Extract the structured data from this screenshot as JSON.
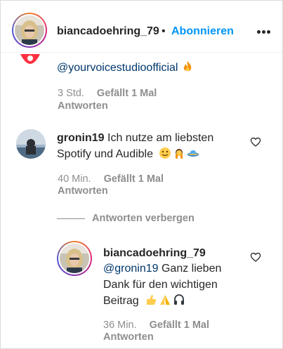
{
  "header": {
    "username": "biancadoehring_79",
    "separator": "•",
    "follow_label": "Abonnieren"
  },
  "partial_comment": {
    "mention": "@yourvoicestudioofficial",
    "time": "3 Std.",
    "likes": "Gefällt 1 Mal",
    "reply_label": "Antworten"
  },
  "comment_gronin": {
    "username": "gronin19",
    "text_line1": "Ich nutze am liebsten",
    "text_line2": "Spotify und Audible",
    "time": "40 Min.",
    "likes": "Gefällt 1 Mal",
    "reply_label": "Antworten"
  },
  "hide_replies_label": "Antworten verbergen",
  "reply_bianca": {
    "username": "biancadoehring_79",
    "mention": "@gronin19",
    "text_line1": "Ganz lieben",
    "text_line2": "Dank für den wichtigen",
    "text_line3": "Beitrag",
    "time": "36 Min.",
    "likes": "Gefällt 1 Mal",
    "reply_label": "Antworten"
  },
  "colors": {
    "text": "#262626",
    "secondary": "#8e8e8e",
    "link": "#0095f6",
    "mention": "#00376b"
  },
  "icons": [
    "more-icon",
    "heart-icon",
    "fire-emoji",
    "smile-emoji",
    "hands-emoji",
    "ufo-emoji",
    "pray-emoji",
    "headphones-emoji"
  ]
}
